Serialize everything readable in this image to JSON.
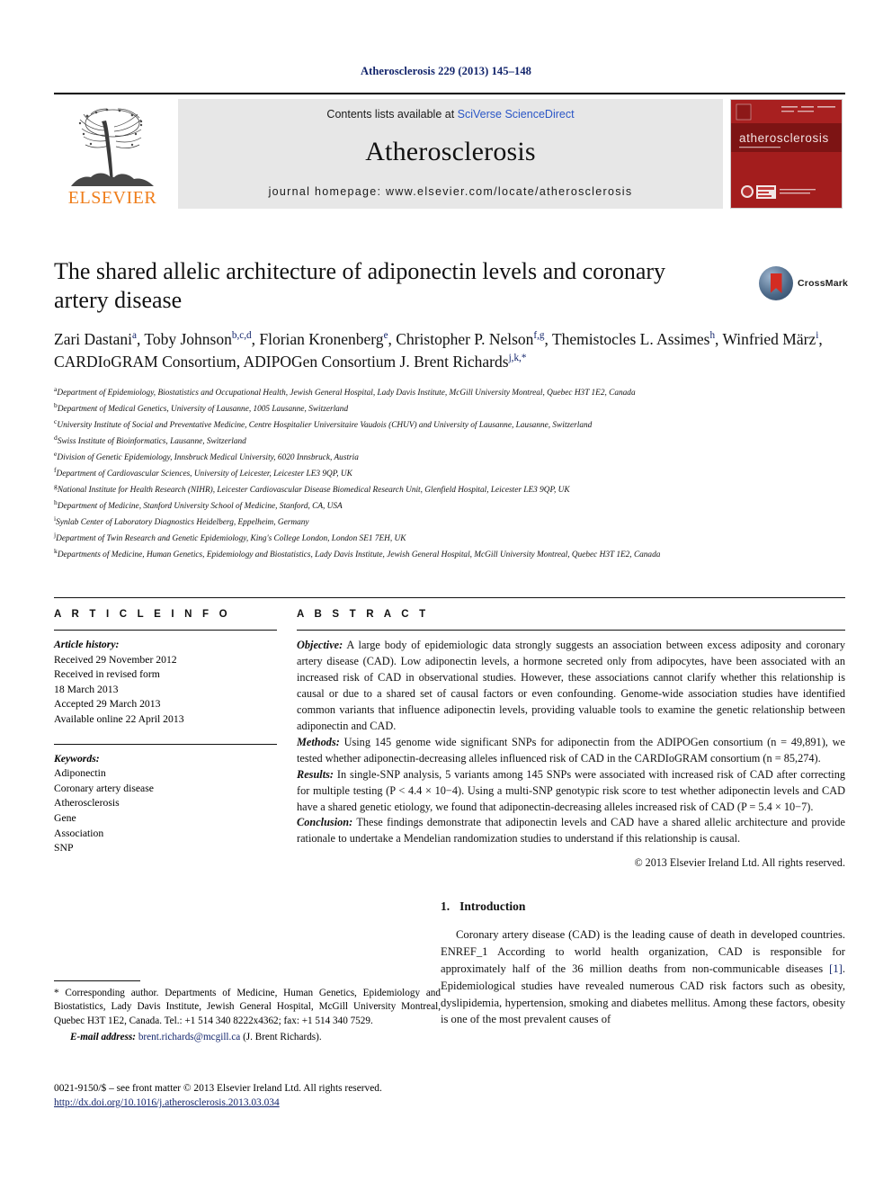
{
  "running_head": "Atherosclerosis 229 (2013) 145–148",
  "masthead": {
    "publisher": "ELSEVIER",
    "contents_prefix": "Contents lists available at ",
    "contents_link": "SciVerse ScienceDirect",
    "journal_name": "Atherosclerosis",
    "homepage": "journal homepage: www.elsevier.com/locate/atherosclerosis",
    "cover_title": "atherosclerosis"
  },
  "article": {
    "title": "The shared allelic architecture of adiponectin levels and coronary artery disease",
    "crossmark_label": "CrossMark",
    "authors_html": "Zari Dastani<sup>a</sup>, Toby Johnson<sup>b,c,d</sup>, Florian Kronenberg<sup>e</sup>, Christopher P. Nelson<sup>f,g</sup>, Themistocles L. Assimes<sup>h</sup>, Winfried März<sup>i</sup>, CARDIoGRAM Consortium, ADIPOGen Consortium J. Brent Richards<sup>j,k,*</sup>",
    "affiliations": [
      {
        "mark": "a",
        "text": "Department of Epidemiology, Biostatistics and Occupational Health, Jewish General Hospital, Lady Davis Institute, McGill University Montreal, Quebec H3T 1E2, Canada"
      },
      {
        "mark": "b",
        "text": "Department of Medical Genetics, University of Lausanne, 1005 Lausanne, Switzerland"
      },
      {
        "mark": "c",
        "text": "University Institute of Social and Preventative Medicine, Centre Hospitalier Universitaire Vaudois (CHUV) and University of Lausanne, Lausanne, Switzerland"
      },
      {
        "mark": "d",
        "text": "Swiss Institute of Bioinformatics, Lausanne, Switzerland"
      },
      {
        "mark": "e",
        "text": "Division of Genetic Epidemiology, Innsbruck Medical University, 6020 Innsbruck, Austria"
      },
      {
        "mark": "f",
        "text": "Department of Cardiovascular Sciences, University of Leicester, Leicester LE3 9QP, UK"
      },
      {
        "mark": "g",
        "text": "National Institute for Health Research (NIHR), Leicester Cardiovascular Disease Biomedical Research Unit, Glenfield Hospital, Leicester LE3 9QP, UK"
      },
      {
        "mark": "h",
        "text": "Department of Medicine, Stanford University School of Medicine, Stanford, CA, USA"
      },
      {
        "mark": "i",
        "text": "Synlab Center of Laboratory Diagnostics Heidelberg, Eppelheim, Germany"
      },
      {
        "mark": "j",
        "text": "Department of Twin Research and Genetic Epidemiology, King's College London, London SE1 7EH, UK"
      },
      {
        "mark": "k",
        "text": "Departments of Medicine, Human Genetics, Epidemiology and Biostatistics, Lady Davis Institute, Jewish General Hospital, McGill University Montreal, Quebec H3T 1E2, Canada"
      }
    ]
  },
  "article_info": {
    "heading": "A R T I C L E   I N F O",
    "history_label": "Article history:",
    "history": [
      "Received 29 November 2012",
      "Received in revised form",
      "18 March 2013",
      "Accepted 29 March 2013",
      "Available online 22 April 2013"
    ],
    "keywords_label": "Keywords:",
    "keywords": [
      "Adiponectin",
      "Coronary artery disease",
      "Atherosclerosis",
      "Gene",
      "Association",
      "SNP"
    ]
  },
  "abstract": {
    "heading": "A B S T R A C T",
    "objective_label": "Objective:",
    "objective_text": " A large body of epidemiologic data strongly suggests an association between excess adiposity and coronary artery disease (CAD). Low adiponectin levels, a hormone secreted only from adipocytes, have been associated with an increased risk of CAD in observational studies. However, these associations cannot clarify whether this relationship is causal or due to a shared set of causal factors or even confounding. Genome-wide association studies have identified common variants that influence adiponectin levels, providing valuable tools to examine the genetic relationship between adiponectin and CAD.",
    "methods_label": "Methods:",
    "methods_text": " Using 145 genome wide significant SNPs for adiponectin from the ADIPOGen consortium (n = 49,891), we tested whether adiponectin-decreasing alleles influenced risk of CAD in the CARDIoGRAM consortium (n = 85,274).",
    "results_label": "Results:",
    "results_text": " In single-SNP analysis, 5 variants among 145 SNPs were associated with increased risk of CAD after correcting for multiple testing (P < 4.4 × 10−4). Using a multi-SNP genotypic risk score to test whether adiponectin levels and CAD have a shared genetic etiology, we found that adiponectin-decreasing alleles increased risk of CAD (P = 5.4 × 10−7).",
    "conclusion_label": "Conclusion:",
    "conclusion_text": " These findings demonstrate that adiponectin levels and CAD have a shared allelic architecture and provide rationale to undertake a Mendelian randomization studies to understand if this relationship is causal.",
    "copyright": "© 2013 Elsevier Ireland Ltd. All rights reserved."
  },
  "introduction": {
    "number": "1.",
    "title": "Introduction",
    "paragraph_pre": "Coronary artery disease (CAD) is the leading cause of death in developed countries. ENREF_1 According to world health organization, CAD is responsible for approximately half of the 36 million deaths from non-communicable diseases ",
    "citation": "[1]",
    "paragraph_post": ". Epidemiological studies have revealed numerous CAD risk factors such as obesity, dyslipidemia, hypertension, smoking and diabetes mellitus. Among these factors, obesity is one of the most prevalent causes of"
  },
  "corresponding": {
    "text": "* Corresponding author. Departments of Medicine, Human Genetics, Epidemiology and Biostatistics, Lady Davis Institute, Jewish General Hospital, McGill University Montreal, Quebec H3T 1E2, Canada. Tel.: +1 514 340 8222x4362; fax: +1 514 340 7529.",
    "email_label": "E-mail address:",
    "email": "brent.richards@mcgill.ca",
    "email_owner": "(J. Brent Richards)."
  },
  "footer": {
    "issn_line": "0021-9150/$ – see front matter © 2013 Elsevier Ireland Ltd. All rights reserved.",
    "doi": "http://dx.doi.org/10.1016/j.atherosclerosis.2013.03.034"
  },
  "colors": {
    "link_blue": "#2a56c6",
    "navy": "#12246b",
    "elsevier_orange": "#ef7d1a",
    "cover_red": "#9e1b1b",
    "band_gray": "#e7e7e7"
  }
}
